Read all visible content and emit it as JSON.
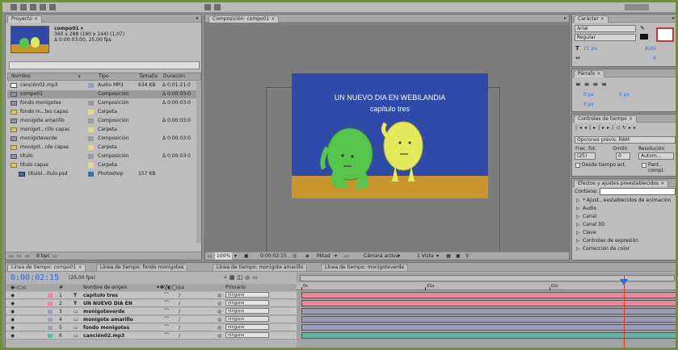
{
  "colors": {
    "accent": "#f07a1e",
    "comp_bg": "#2f4aa8",
    "comp_ground": "#c8962a",
    "char_left": "#57c44c",
    "char_right": "#e2ea5a",
    "timecode": "#2b6fd6"
  },
  "project": {
    "tab": "Proyecto",
    "comp_name": "compo01 ▾",
    "comp_info1": "360 x 288 (180 x 144) (1,07)",
    "comp_info2": "Δ 0:00:03:00, 25,00 fps",
    "columns": [
      "Nombre",
      "Tipo",
      "Tamaño",
      "Duración"
    ],
    "items": [
      {
        "name": "canción02.mp3",
        "type": "Audio MP3",
        "size": "634 KB",
        "dur": "Δ 0:01:21:0",
        "icon": "audio",
        "label": "#8fa0c8",
        "indent": 0
      },
      {
        "name": "compo01",
        "type": "Composición",
        "size": "",
        "dur": "Δ 0:00:03:0",
        "icon": "comp",
        "label": "#9a9a9a",
        "indent": 0
      },
      {
        "name": "fondo monigotes",
        "type": "Composición",
        "size": "",
        "dur": "Δ 0:00:03:0",
        "icon": "comp",
        "label": "#9a9a9a",
        "indent": 0
      },
      {
        "name": "fondo m...tes capas",
        "type": "Carpeta",
        "size": "",
        "dur": "",
        "icon": "folder",
        "label": "#e8d78a",
        "indent": 0
      },
      {
        "name": "monigote amarillo",
        "type": "Composición",
        "size": "",
        "dur": "Δ 0:00:03:0",
        "icon": "comp",
        "label": "#9a9a9a",
        "indent": 0
      },
      {
        "name": "monigot...rillo capas",
        "type": "Carpeta",
        "size": "",
        "dur": "",
        "icon": "folder",
        "label": "#e8d78a",
        "indent": 0
      },
      {
        "name": "monigoteverde",
        "type": "Composición",
        "size": "",
        "dur": "Δ 0:00:03:0",
        "icon": "comp",
        "label": "#9a9a9a",
        "indent": 0
      },
      {
        "name": "monigot...rde capas",
        "type": "Carpeta",
        "size": "",
        "dur": "",
        "icon": "folder",
        "label": "#e8d78a",
        "indent": 0
      },
      {
        "name": "título",
        "type": "Composición",
        "size": "",
        "dur": "Δ 0:00:03:0",
        "icon": "comp",
        "label": "#9a9a9a",
        "indent": 0
      },
      {
        "name": "título capas",
        "type": "Carpeta",
        "size": "",
        "dur": "",
        "icon": "folder",
        "label": "#e8d78a",
        "indent": 0
      },
      {
        "name": "títulol...ítulo.psd",
        "type": "Photoshop",
        "size": "157 KB",
        "dur": "",
        "icon": "psd",
        "label": "#3a6ea5",
        "indent": 1
      }
    ],
    "footer": "8 bpc"
  },
  "composition": {
    "tab": "Composición: compo01",
    "title_line1": "UN NUEVO DIA EN  WEBILANDIA",
    "title_line2": "capítulo tres",
    "zoom": "100%",
    "timecode": "0:00:02:15",
    "resolution": "Mitad",
    "camera": "Cámara activa",
    "views": "1 Vista"
  },
  "character": {
    "tab": "Carácter",
    "font": "Arial",
    "style": "Regular",
    "size": "21 px",
    "leading": "Auto",
    "kerning": "0"
  },
  "paragraph": {
    "tab": "Párrafo",
    "indent": "0 px"
  },
  "time_controls": {
    "tab": "Controles de tiempo",
    "ram_options": "Opciones previs. RAM",
    "fps_label": "Frec. fot.",
    "skip_label": "Omitir",
    "res_label": "Resolución",
    "fps": "(25)",
    "skip": "0",
    "res": "Autom...",
    "from_current": "Desde tiempo act.",
    "full_screen": "Pant. compl."
  },
  "effects": {
    "tab": "Efectos y ajustes preestablecidos",
    "contains_label": "Contiene:",
    "items": [
      "* Ajust...eestablecidos de animación",
      "Audio",
      "Canal",
      "Canal 3D",
      "Clave",
      "Controles de expresión",
      "Corrección de color"
    ]
  },
  "timeline": {
    "tabs": [
      "Línea de tiempo: compo01",
      "Línea de tiempo: fondo monigotes",
      "Línea de tiempo: monigote amarillo",
      "Línea de tiempo: monigoteverde"
    ],
    "timecode": "0:00:02:15",
    "fps": "(25,00 fps)",
    "col_name": "Nombre de origen",
    "col_parent": "Primario",
    "ruler": [
      "0s",
      "01s",
      "02s"
    ],
    "playhead": 2.6,
    "duration": 3.0,
    "layers": [
      {
        "num": "1",
        "name": "capítulo tres",
        "type": "T",
        "parent": "ninguno",
        "color": "#e58a9a"
      },
      {
        "num": "2",
        "name": "UN NUEVO DIA EN",
        "type": "T",
        "parent": "ninguno",
        "color": "#e58a9a"
      },
      {
        "num": "3",
        "name": "monigoteverde",
        "type": "C",
        "parent": "ninguno",
        "color": "#9d9db5"
      },
      {
        "num": "4",
        "name": "monigote amarillo",
        "type": "C",
        "parent": "ninguno",
        "color": "#9d9db5"
      },
      {
        "num": "5",
        "name": "fondo monigotes",
        "type": "C",
        "parent": "ninguno",
        "color": "#9d9db5"
      },
      {
        "num": "6",
        "name": "canción02.mp3",
        "type": "A",
        "parent": "ninguno",
        "color": "#62b3a4"
      }
    ]
  }
}
